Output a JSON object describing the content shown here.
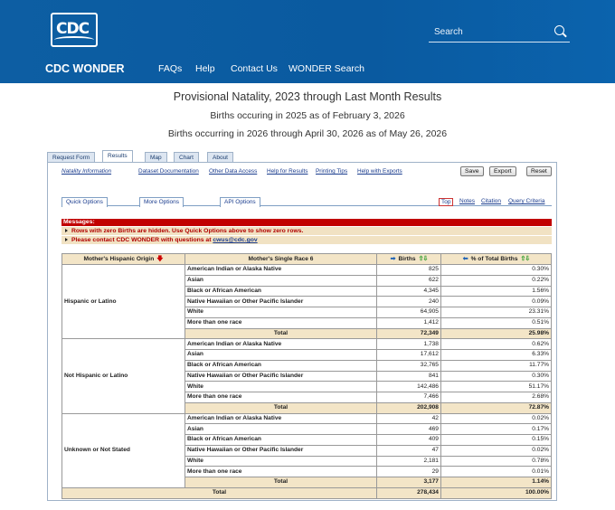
{
  "header": {
    "logo_text": "CDC",
    "search_placeholder": "Search",
    "brand": "CDC WONDER",
    "nav": [
      "FAQs",
      "Help",
      "Contact Us",
      "WONDER Search"
    ]
  },
  "titles": {
    "main": "Provisional Natality, 2023 through Last Month Results",
    "line2": "Births occuring in 2025 as of February 3, 2026",
    "line3": "Births occurring in 2026 through April 30, 2026 as of May 26, 2026"
  },
  "tabs": [
    "Request Form",
    "Results",
    "Map",
    "Chart",
    "About"
  ],
  "links": [
    "Natality Information",
    "Dataset Documentation",
    "Other Data Access",
    "Help for Results",
    "Printing Tips",
    "Help with Exports"
  ],
  "buttons": [
    "Save",
    "Export",
    "Reset"
  ],
  "subtabs": [
    "Quick Options",
    "More Options",
    "API Options"
  ],
  "right_links": [
    "Top",
    "Notes",
    "Citation",
    "Query Criteria"
  ],
  "messages": {
    "heading": "Messages:",
    "line1": "Rows with zero Births are hidden. Use Quick Options above to show zero rows.",
    "line2_prefix": "Please contact CDC WONDER with questions at ",
    "email": "cwus@cdc.gov"
  },
  "table": {
    "headers": {
      "origin": "Mother's Hispanic Origin",
      "race": "Mother's Single Race 6",
      "births": "Births",
      "pct": "% of Total Births"
    },
    "groups": [
      {
        "label": "Hispanic or Latino",
        "rows": [
          {
            "race": "American Indian or Alaska Native",
            "births": "825",
            "pct": "0.30%"
          },
          {
            "race": "Asian",
            "births": "622",
            "pct": "0.22%"
          },
          {
            "race": "Black or African American",
            "births": "4,345",
            "pct": "1.56%"
          },
          {
            "race": "Native Hawaiian or Other Pacific Islander",
            "births": "240",
            "pct": "0.09%"
          },
          {
            "race": "White",
            "births": "64,905",
            "pct": "23.31%"
          },
          {
            "race": "More than one race",
            "births": "1,412",
            "pct": "0.51%"
          }
        ],
        "total": {
          "label": "Total",
          "births": "72,349",
          "pct": "25.98%"
        }
      },
      {
        "label": "Not Hispanic or Latino",
        "rows": [
          {
            "race": "American Indian or Alaska Native",
            "births": "1,738",
            "pct": "0.62%"
          },
          {
            "race": "Asian",
            "births": "17,612",
            "pct": "6.33%"
          },
          {
            "race": "Black or African American",
            "births": "32,765",
            "pct": "11.77%"
          },
          {
            "race": "Native Hawaiian or Other Pacific Islander",
            "births": "841",
            "pct": "0.30%"
          },
          {
            "race": "White",
            "births": "142,486",
            "pct": "51.17%"
          },
          {
            "race": "More than one race",
            "births": "7,466",
            "pct": "2.68%"
          }
        ],
        "total": {
          "label": "Total",
          "births": "202,908",
          "pct": "72.87%"
        }
      },
      {
        "label": "Unknown or Not Stated",
        "rows": [
          {
            "race": "American Indian or Alaska Native",
            "births": "42",
            "pct": "0.02%"
          },
          {
            "race": "Asian",
            "births": "469",
            "pct": "0.17%"
          },
          {
            "race": "Black or African American",
            "births": "409",
            "pct": "0.15%"
          },
          {
            "race": "Native Hawaiian or Other Pacific Islander",
            "births": "47",
            "pct": "0.02%"
          },
          {
            "race": "White",
            "births": "2,181",
            "pct": "0.78%"
          },
          {
            "race": "More than one race",
            "births": "29",
            "pct": "0.01%"
          }
        ],
        "total": {
          "label": "Total",
          "births": "3,177",
          "pct": "1.14%"
        }
      }
    ],
    "grand_total": {
      "label": "Total",
      "births": "278,434",
      "pct": "100.00%"
    }
  },
  "colors": {
    "header_blue": "#0d5ea3",
    "message_red": "#c10000",
    "table_tan": "#f3e5c7"
  }
}
